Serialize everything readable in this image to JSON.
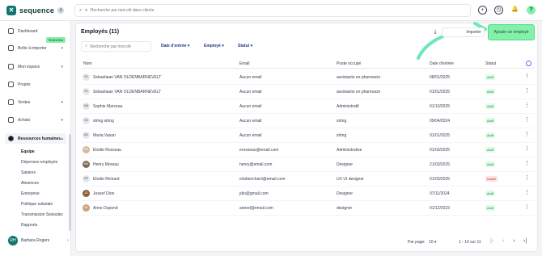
{
  "app": {
    "logo_text": "sequence",
    "logo_badge": "4"
  },
  "top_search": {
    "placeholder": "Recherche par mot-clé dans clients"
  },
  "top_icons": [
    "plus-circle-icon",
    "clock-icon",
    "bell-icon",
    "help-icon"
  ],
  "sidebar": {
    "items": [
      {
        "label": "Dashboard"
      },
      {
        "label": "Boîte à importer"
      },
      {
        "label": "Mon espace"
      },
      {
        "label": "Projets"
      },
      {
        "label": "Ventes"
      },
      {
        "label": "Achats"
      },
      {
        "label": "Ressources humaines"
      }
    ],
    "new_badge": "Nouveau",
    "sub_items": [
      "Equipe",
      "Dépenses employés",
      "Salaires",
      "Absences",
      "Entreprise",
      "Politique salariale",
      "Transmission Swissdec",
      "Rapports"
    ],
    "user": {
      "initials": "RH",
      "name": "Barbara Rogers"
    }
  },
  "main": {
    "title": "Employés (11)",
    "import_label": "Importer",
    "add_label": "Ajouter un employé",
    "search_placeholder": "Recherche par mot-clé",
    "filters": [
      "Date d'entrée",
      "Employé",
      "Statut"
    ],
    "columns": [
      "Nom",
      "Email",
      "Poste occupé",
      "Date d'entrée",
      "Statut"
    ],
    "rows": [
      {
        "initials": "SV",
        "name": "Sebastiaan VAN OLDENBARNEVELT",
        "email": "Aucun email",
        "role": "assistante en pharmacie",
        "date": "08/01/2025",
        "status": "Actif"
      },
      {
        "initials": "SV",
        "name": "Sebastiaan VAN OLDENBARNEVELT",
        "email": "Aucun email",
        "role": "assistante en pharmacie",
        "date": "01/01/2025",
        "status": "Actif"
      },
      {
        "initials": "SM",
        "name": "Sophie Marceau",
        "email": "Aucun email",
        "role": "Administratif",
        "date": "01/10/2025",
        "status": "Actif"
      },
      {
        "initials": "SS",
        "name": "string string",
        "email": "Aucun email",
        "role": "string",
        "date": "09/04/2024",
        "status": "Actif"
      },
      {
        "initials": "MV",
        "name": "Maria Vasari",
        "email": "Aucun email",
        "role": "string",
        "date": "01/01/2025",
        "status": "Actif"
      },
      {
        "initials": "ER",
        "name": "Elodie Rosseau",
        "email": "erosseau@email.com",
        "role": "Administrative",
        "date": "01/03/2025",
        "status": "Actif"
      },
      {
        "initials": "HM",
        "name": "Henry Moreau",
        "email": "henry@email.com",
        "role": "Designer",
        "date": "21/03/2025",
        "status": "Actif"
      },
      {
        "initials": "ER",
        "name": "Elodie Richard",
        "email": "elodierichard@email.com",
        "role": "UX UI designer",
        "date": "01/03/2025",
        "status": "Inactif"
      },
      {
        "initials": "JD",
        "name": "Joseef Dion",
        "email": "jdio@gmail.com",
        "role": "Designer",
        "date": "07/11/2024",
        "status": "Actif"
      },
      {
        "initials": "AD",
        "name": "Anne Dupond",
        "email": "anned@email.com",
        "role": "designer",
        "date": "01/12/2023",
        "status": "Actif"
      }
    ],
    "pagination": {
      "per_page_label": "Par page:",
      "per_page": "10",
      "range": "1 - 10 sur 11"
    }
  },
  "colors": {
    "accent": "#86efac",
    "brand": "#0f766e",
    "filter_text": "#1e3a8a"
  }
}
